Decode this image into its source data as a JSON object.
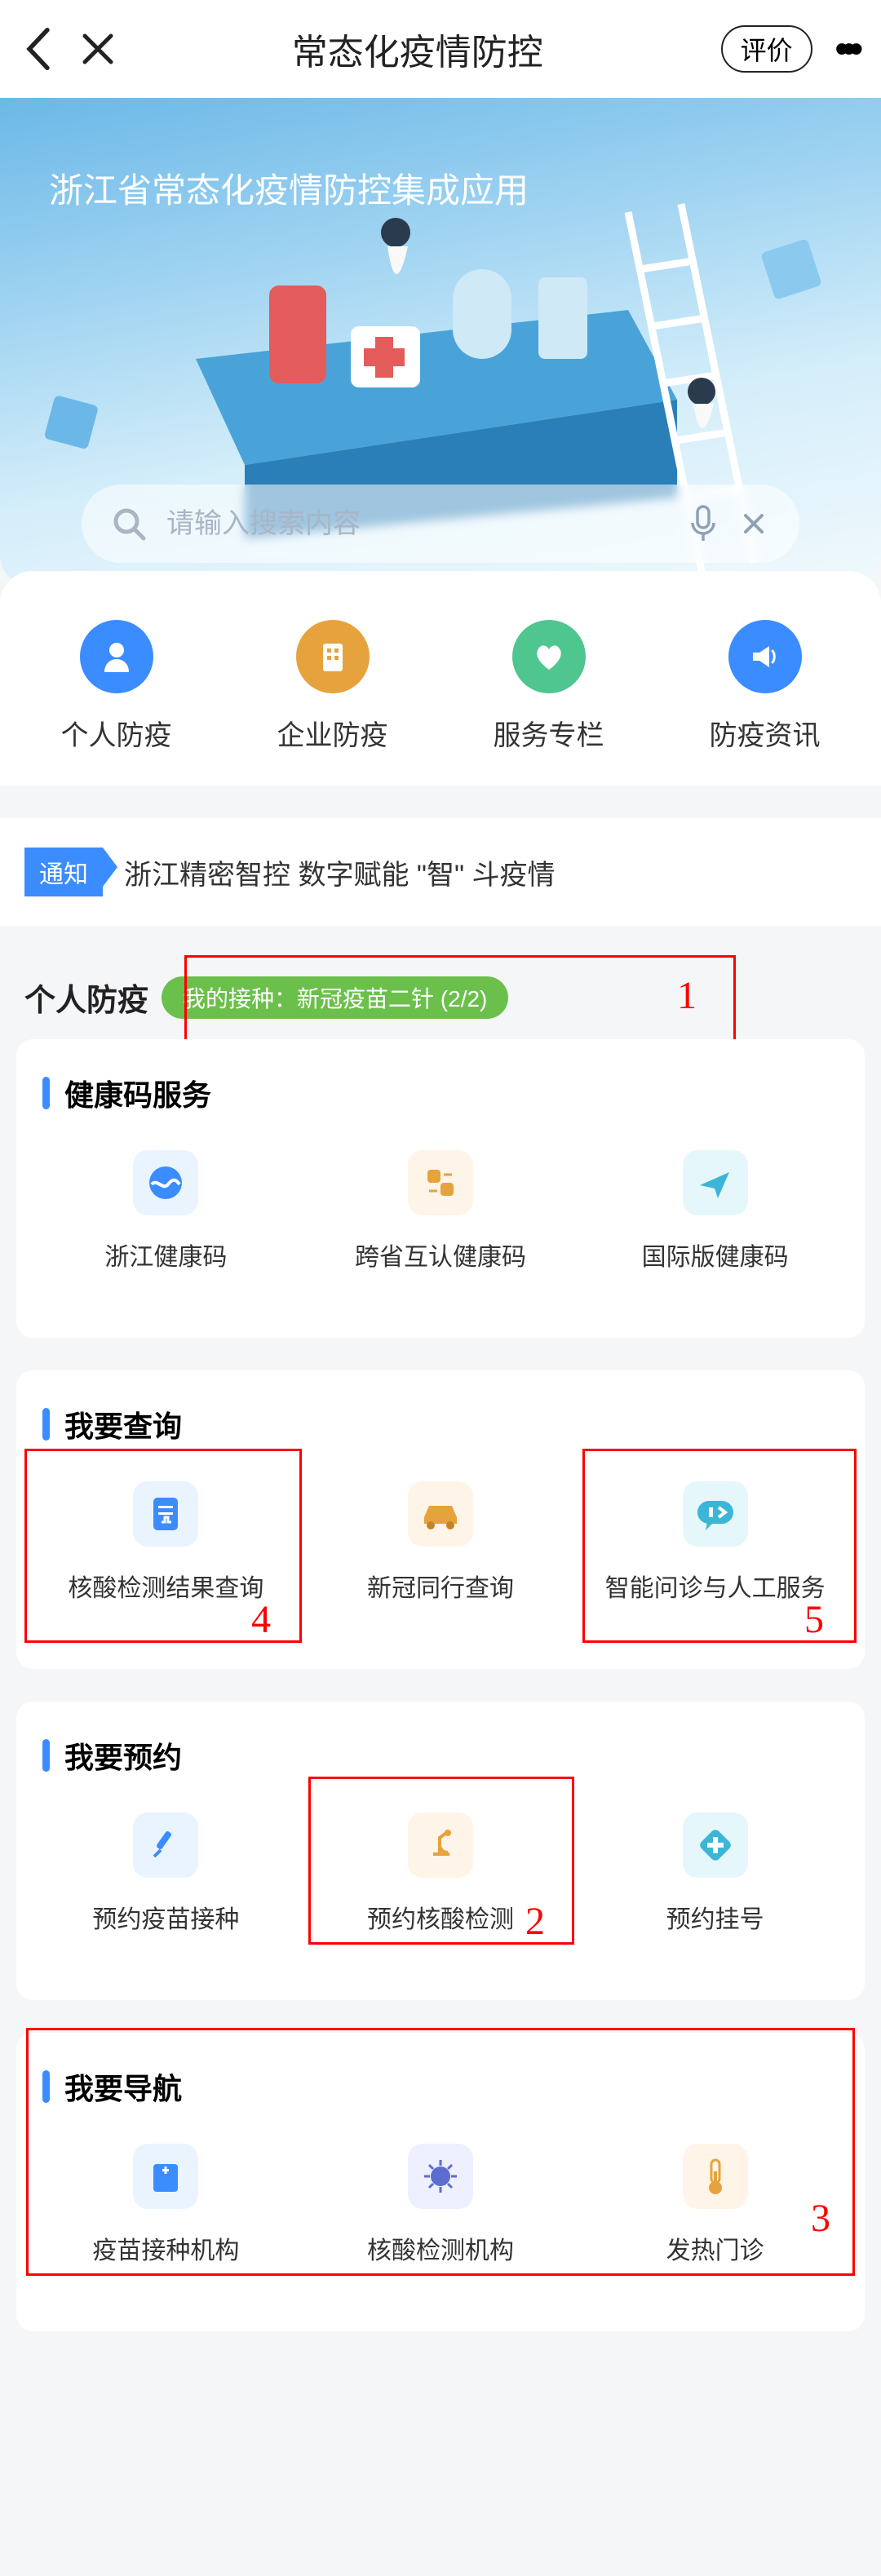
{
  "header": {
    "title": "常态化疫情防控",
    "evaluate": "评价"
  },
  "hero": {
    "title": "浙江省常态化疫情防控集成应用",
    "search_placeholder": "请输入搜索内容"
  },
  "nav": [
    {
      "label": "个人防疫",
      "color": "#3b8cff"
    },
    {
      "label": "企业防疫",
      "color": "#e6a23c"
    },
    {
      "label": "服务专栏",
      "color": "#4fc58f"
    },
    {
      "label": "防疫资讯",
      "color": "#3b8cff"
    }
  ],
  "notice": {
    "badge": "通知",
    "text": "浙江精密智控 数字赋能 \"智\" 斗疫情"
  },
  "personal": {
    "title": "个人防疫",
    "vacc_chip": "我的接种：新冠疫苗二针 (2/2)"
  },
  "cards": {
    "health": {
      "title": "健康码服务",
      "items": [
        "浙江健康码",
        "跨省互认健康码",
        "国际版健康码"
      ]
    },
    "query": {
      "title": "我要查询",
      "items": [
        "核酸检测结果查询",
        "新冠同行查询",
        "智能问诊与人工服务"
      ]
    },
    "appoint": {
      "title": "我要预约",
      "items": [
        "预约疫苗接种",
        "预约核酸检测",
        "预约挂号"
      ]
    },
    "navi": {
      "title": "我要导航",
      "items": [
        "疫苗接种机构",
        "核酸检测机构",
        "发热门诊"
      ]
    }
  },
  "annotations": [
    "1",
    "2",
    "3",
    "4",
    "5"
  ]
}
